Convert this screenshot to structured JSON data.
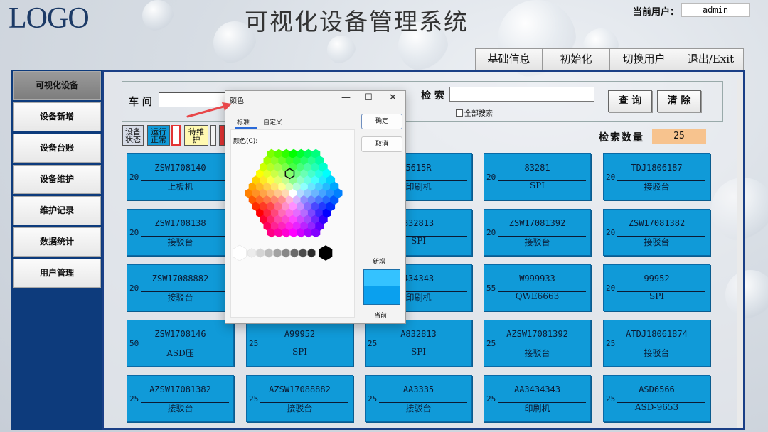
{
  "header": {
    "logo": "LOGO",
    "title": "可视化设备管理系统",
    "user_label": "当前用户：",
    "user_value": "admin"
  },
  "top_menu": [
    {
      "label": "基础信息"
    },
    {
      "label": "初始化"
    },
    {
      "label": "切换用户"
    },
    {
      "label": "退出/Exit"
    }
  ],
  "sidebar": {
    "items": [
      {
        "label": "可视化设备",
        "active": true
      },
      {
        "label": "设备新增"
      },
      {
        "label": "设备台账"
      },
      {
        "label": "设备维护"
      },
      {
        "label": "维护记录"
      },
      {
        "label": "数据统计"
      },
      {
        "label": "用户管理"
      }
    ]
  },
  "search": {
    "workshop_label": "车 间",
    "workshop_value": "",
    "keyword_label": "检 索",
    "keyword_value": "",
    "all_search_label": "全部搜索",
    "query_button": "查 询",
    "clear_button": "清 除"
  },
  "status_buttons": [
    {
      "label": "设备\n状态",
      "color": "#d6dbe6"
    },
    {
      "label": "运行\n正常",
      "color": "#109ad8"
    },
    {
      "label": "",
      "color": "#ffffff"
    },
    {
      "label": "待维\n护",
      "color": "#fff9b0"
    }
  ],
  "count": {
    "label": "检索数量",
    "value": "25"
  },
  "cards": [
    {
      "code": "ZSW1708140",
      "num": "20",
      "name": "上板机"
    },
    {
      "code": "",
      "num": "",
      "name": ""
    },
    {
      "code": "5615R",
      "num": "",
      "name": "印刷机"
    },
    {
      "code": "83281",
      "num": "20",
      "name": "SPI"
    },
    {
      "code": "TDJ1806187",
      "num": "20",
      "name": "接驳台"
    },
    {
      "code": "ZSW1708138",
      "num": "20",
      "name": "接驳台"
    },
    {
      "code": "",
      "num": "",
      "name": ""
    },
    {
      "code": "832813",
      "num": "",
      "name": "SPI"
    },
    {
      "code": "ZSW17081392",
      "num": "20",
      "name": "接驳台"
    },
    {
      "code": "ZSW17081382",
      "num": "20",
      "name": "接驳台"
    },
    {
      "code": "ZSW17088882",
      "num": "20",
      "name": "接驳台"
    },
    {
      "code": "",
      "num": "",
      "name": ""
    },
    {
      "code": "434343",
      "num": "",
      "name": "印刷机"
    },
    {
      "code": "W999933",
      "num": "55",
      "name": "QWE6663"
    },
    {
      "code": "99952",
      "num": "20",
      "name": "SPI"
    },
    {
      "code": "ZSW1708146",
      "num": "50",
      "name": "ASD压"
    },
    {
      "code": "A99952",
      "num": "25",
      "name": "SPI"
    },
    {
      "code": "A832813",
      "num": "25",
      "name": "SPI"
    },
    {
      "code": "AZSW17081392",
      "num": "25",
      "name": "接驳台"
    },
    {
      "code": "ATDJ18061874",
      "num": "25",
      "name": "接驳台"
    },
    {
      "code": "AZSW17081382",
      "num": "25",
      "name": "接驳台"
    },
    {
      "code": "AZSW17088882",
      "num": "25",
      "name": "接驳台"
    },
    {
      "code": "AA3335",
      "num": "25",
      "name": "接驳台"
    },
    {
      "code": "AA3434343",
      "num": "25",
      "name": "印刷机"
    },
    {
      "code": "ASD6566",
      "num": "25",
      "name": "ASD-9653"
    }
  ],
  "color_dialog": {
    "title": "颜色",
    "minimize_icon": "—",
    "maximize_icon": "☐",
    "close_icon": "✕",
    "tab_standard": "标准",
    "tab_custom": "自定义",
    "palette_label": "颜色(C):",
    "ok_button": "确定",
    "cancel_button": "取消",
    "new_label": "新增",
    "current_label": "当前",
    "new_color": "#34c2ff",
    "current_color": "#0aa0ee"
  },
  "colors": {
    "card": "#109ad8",
    "sidebar": "#0d3b7c",
    "count_box": "#f7c38e",
    "arrow": "#e8474a"
  }
}
